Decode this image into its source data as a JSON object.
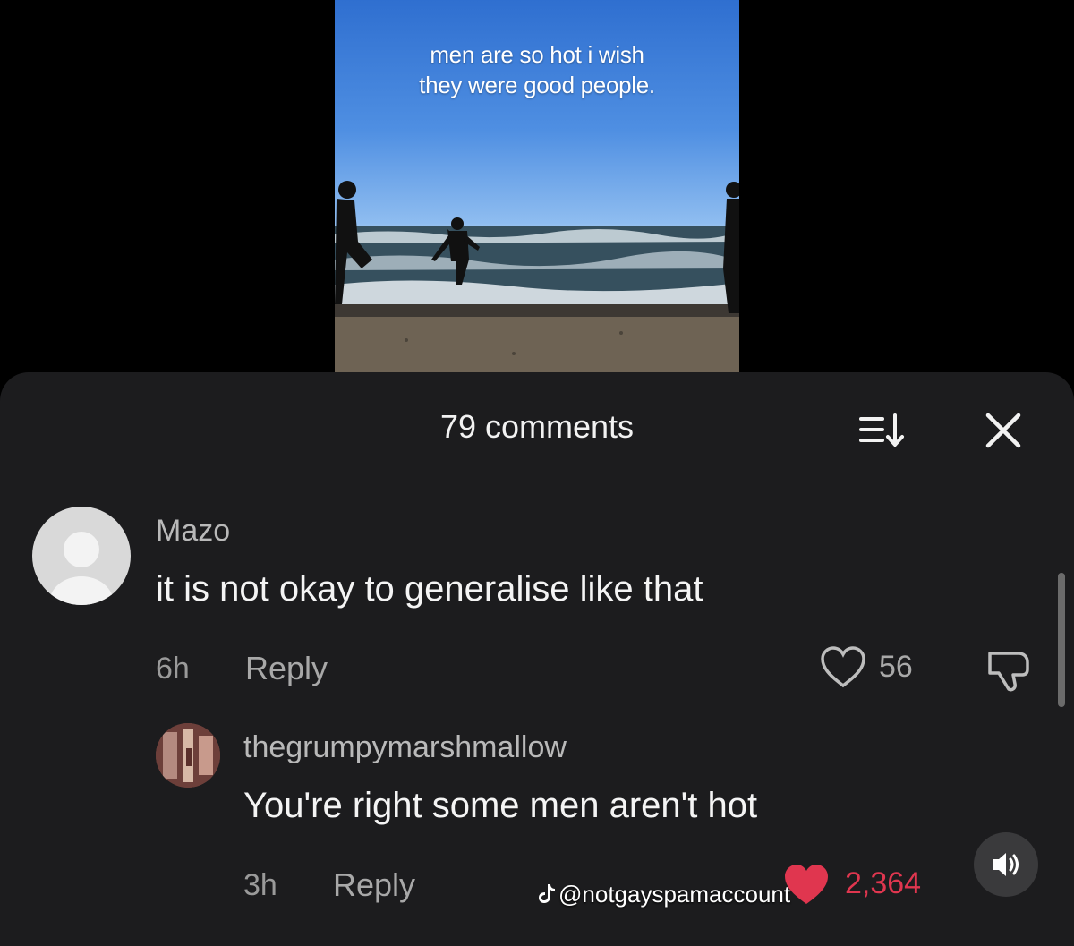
{
  "video": {
    "caption_line1": "men are so hot i wish",
    "caption_line2": "they were good people."
  },
  "comments_panel": {
    "count_label": "79 comments",
    "sort_icon": "sort-icon",
    "close_icon": "close-icon"
  },
  "comments": [
    {
      "username": "Mazo",
      "text": "it is not okay to generalise like that",
      "time": "6h",
      "reply_label": "Reply",
      "likes": "56",
      "liked": false
    },
    {
      "username": "thegrumpymarshmallow",
      "text": "You're right some men aren't hot",
      "time": "3h",
      "reply_label": "Reply",
      "likes": "2,364",
      "liked": true
    }
  ],
  "watermark": {
    "handle": "@notgayspamaccount"
  },
  "colors": {
    "sheet_bg": "#1c1c1e",
    "liked_heart": "#e0364f",
    "liked_count": "#e0364f"
  }
}
